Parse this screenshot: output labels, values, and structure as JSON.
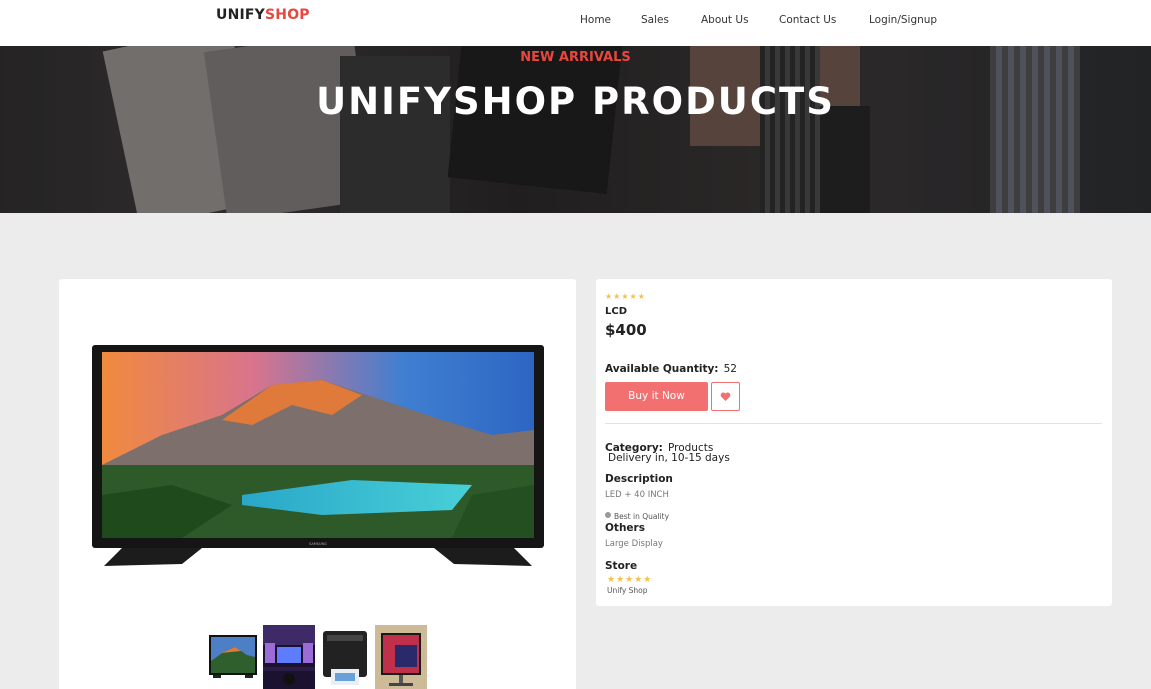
{
  "brand": {
    "part1": "UNIFY",
    "part2": "SHOP"
  },
  "nav": {
    "home": "Home",
    "sales": "Sales",
    "about": "About Us",
    "contact": "Contact Us",
    "login": "Login/Signup"
  },
  "hero": {
    "subtitle": "NEW ARRIVALS",
    "title": "UNIFYSHOP PRODUCTS"
  },
  "product": {
    "stars": "★★★★★",
    "name": "LCD",
    "price": "$400",
    "quantity_label": "Available Quantity:",
    "quantity_value": "52",
    "buy_label": "Buy it Now",
    "category_label": "Category:",
    "category_value": "Products",
    "delivery": "Delivery in, 10-15 days",
    "description_label": "Description",
    "description_value": "LED + 40 INCH",
    "quality_tag": "Best in Quality",
    "others_label": "Others",
    "others_value": "Large Display",
    "store_label": "Store",
    "store_stars": "★★★★★",
    "store_name": "Unify Shop",
    "tv_brand": "SAMSUNG"
  },
  "thumbnails": [
    "tv",
    "gaming-room",
    "printer",
    "monitor"
  ],
  "colors": {
    "accent": "#e8473f",
    "button": "#f37070",
    "star": "#f2c14e",
    "background": "#ececec"
  }
}
